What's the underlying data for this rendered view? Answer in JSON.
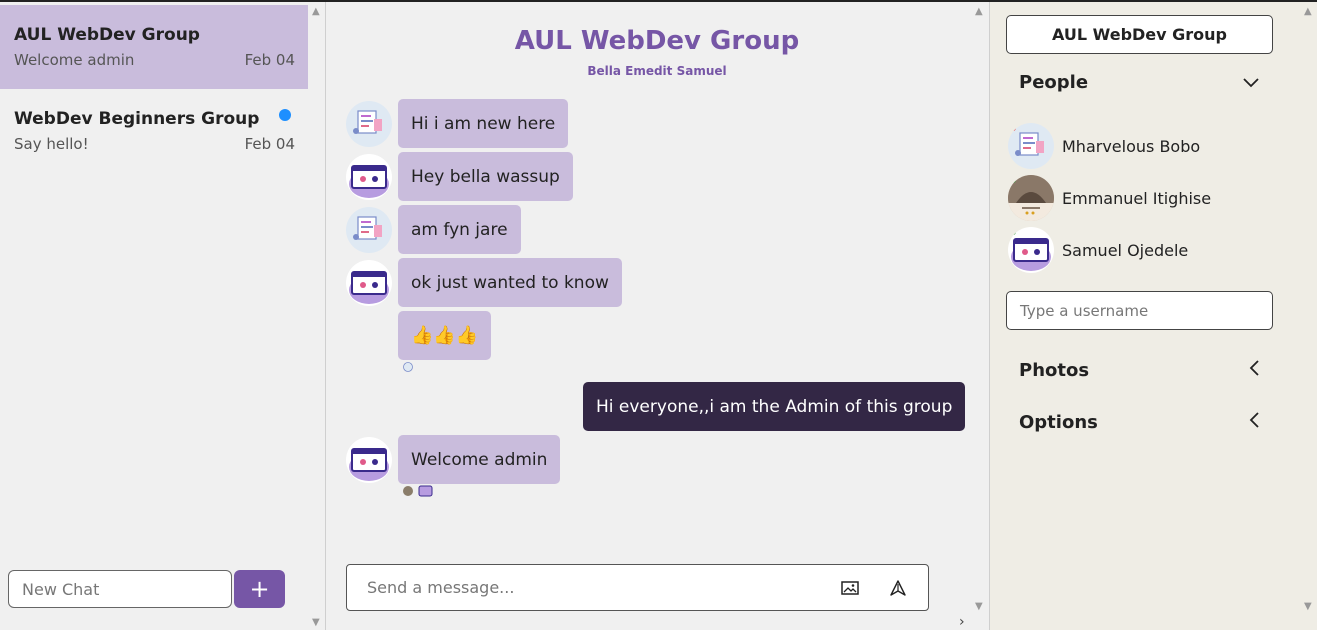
{
  "sidebar": {
    "chats": [
      {
        "name": "AUL WebDev Group",
        "preview": "Welcome admin",
        "date": "Feb 04",
        "active": true,
        "unread": false
      },
      {
        "name": "WebDev Beginners Group",
        "preview": "Say hello!",
        "date": "Feb 04",
        "active": false,
        "unread": true
      }
    ],
    "new_chat_placeholder": "New Chat",
    "add_button_label": "+"
  },
  "conversation": {
    "title": "AUL WebDev Group",
    "members": "Bella Emedit Samuel",
    "messages": [
      {
        "text": "Hi i am new here",
        "sender": "bella",
        "mine": false
      },
      {
        "text": "Hey bella wassup",
        "sender": "samuel",
        "mine": false
      },
      {
        "text": "am fyn jare",
        "sender": "bella",
        "mine": false
      },
      {
        "text": "ok just wanted to know",
        "sender": "samuel",
        "mine": false
      },
      {
        "text": "👍👍👍",
        "sender": "samuel",
        "mine": false
      },
      {
        "text": "Hi everyone,,i am the Admin of this group",
        "sender": "admin",
        "mine": true
      },
      {
        "text": "Welcome admin",
        "sender": "samuel",
        "mine": false
      }
    ],
    "composer_placeholder": "Send a message..."
  },
  "details": {
    "title": "AUL WebDev Group",
    "people_heading": "People",
    "people": [
      {
        "name": "Mharvelous Bobo",
        "status_color": "#e53935"
      },
      {
        "name": "Emmanuel Itighise",
        "status_color": "#43a047"
      },
      {
        "name": "Samuel Ojedele",
        "status_color": "#43a047"
      }
    ],
    "username_placeholder": "Type a username",
    "photos_heading": "Photos",
    "options_heading": "Options"
  },
  "colors": {
    "accent": "#7656a6",
    "bubble": "#c9bcdc",
    "own_bubble": "#332745",
    "unread_dot": "#1e8fff"
  }
}
